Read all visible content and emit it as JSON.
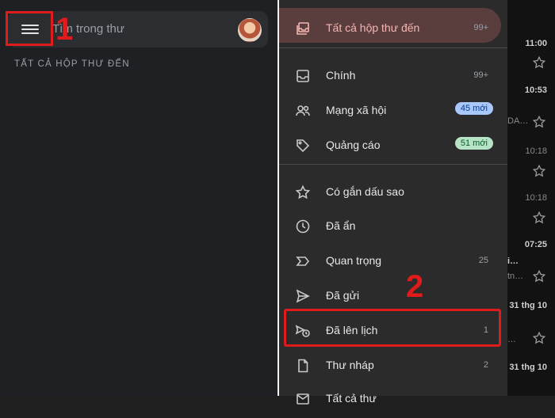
{
  "left": {
    "search_placeholder": "Tìm trong thư",
    "section_label": "TẤT CẢ HỘP THƯ ĐẾN",
    "step_number": "1"
  },
  "drawer": {
    "items": [
      {
        "label": "Tất cả hộp thư đến",
        "count": "99+",
        "icon": "inbox-stack-icon",
        "active": true
      },
      {
        "label": "Chính",
        "count": "99+",
        "icon": "inbox-icon"
      },
      {
        "label": "Mạng xã hội",
        "badge": "45 mới",
        "badge_color": "#a8c7fa",
        "icon": "people-icon"
      },
      {
        "label": "Quảng cáo",
        "badge": "51 mới",
        "badge_color": "#b7e4c7",
        "icon": "tag-icon"
      },
      {
        "label": "Có gắn dấu sao",
        "count": "",
        "icon": "star-icon"
      },
      {
        "label": "Đã ẩn",
        "count": "",
        "icon": "clock-icon"
      },
      {
        "label": "Quan trọng",
        "count": "25",
        "icon": "important-icon"
      },
      {
        "label": "Đã gửi",
        "count": "",
        "icon": "send-icon"
      },
      {
        "label": "Đã lên lịch",
        "count": "1",
        "icon": "scheduled-send-icon"
      },
      {
        "label": "Thư nháp",
        "count": "2",
        "icon": "draft-icon"
      },
      {
        "label": "Tất cả thư",
        "count": "",
        "icon": "all-mail-icon"
      }
    ],
    "step_number": "2"
  },
  "mail_peek": {
    "times": [
      "11:00",
      "10:53",
      "10:18",
      "10:18",
      "07:25",
      "31 thg 10",
      "31 thg 10"
    ],
    "fragments": [
      "DA…",
      "i…",
      "tn…",
      "…"
    ]
  },
  "colors": {
    "highlight": "#e01b1b",
    "active_bg": "#5a3d3d",
    "active_text": "#f5b7b1"
  }
}
